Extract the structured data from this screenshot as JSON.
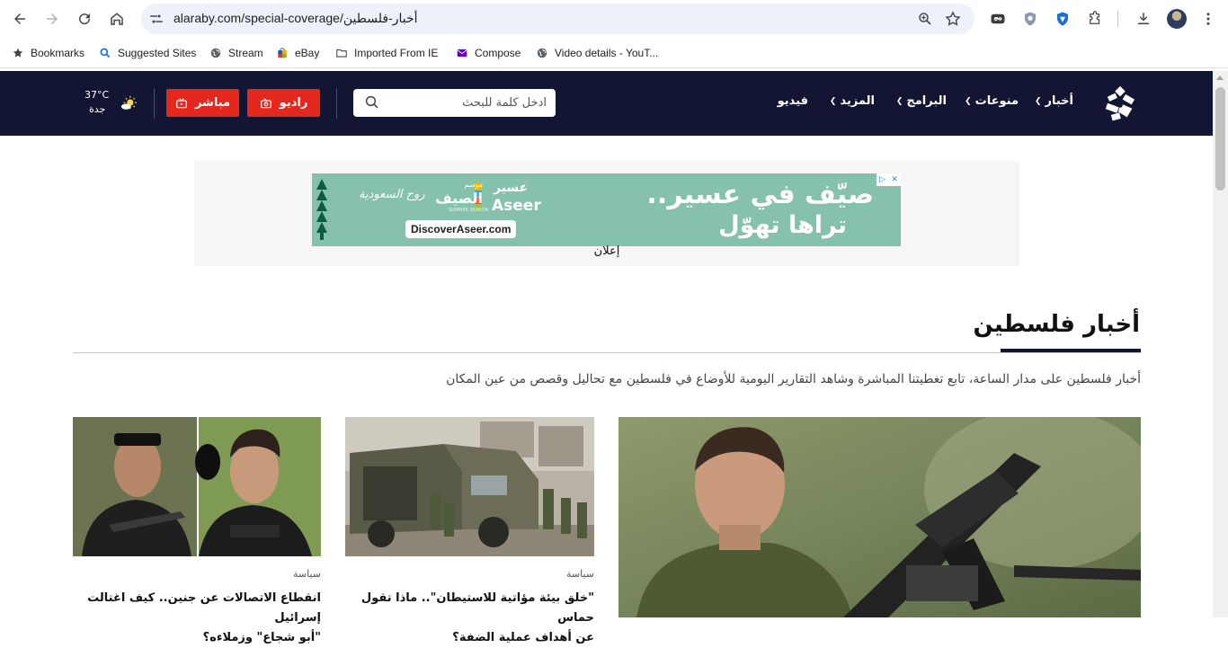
{
  "browser": {
    "url_host": "alaraby.com",
    "url_path": "/special-coverage/أخبار-فلسطين",
    "bookmarks": [
      {
        "label": "Bookmarks",
        "icon": "star-icon"
      },
      {
        "label": "Suggested Sites",
        "icon": "search-icon"
      },
      {
        "label": "Stream",
        "icon": "globe-icon"
      },
      {
        "label": "eBay",
        "icon": "shopping-bag-icon"
      },
      {
        "label": "Imported From IE",
        "icon": "folder-icon"
      },
      {
        "label": "Compose",
        "icon": "mail-icon"
      },
      {
        "label": "Video details - YouT...",
        "icon": "globe-icon"
      }
    ]
  },
  "header": {
    "nav": [
      {
        "label": "أخبار",
        "has_dropdown": true
      },
      {
        "label": "منوعات",
        "has_dropdown": true
      },
      {
        "label": "البرامج",
        "has_dropdown": true
      },
      {
        "label": "المزيد",
        "has_dropdown": true
      },
      {
        "label": "فيديو",
        "has_dropdown": false
      }
    ],
    "search_placeholder": "ادخل كلمة للبحث",
    "radio_label": "راديو",
    "live_label": "مباشر",
    "weather": {
      "temp": "37°C",
      "city": "جدة"
    },
    "colors": {
      "bar": "#121633",
      "accent": "#e4281e"
    }
  },
  "ad": {
    "headline_line1": "صيّف في عسير..",
    "headline_line2": "تراها تهوّل",
    "brand_ar": "عسير",
    "brand_en": "Aseer",
    "season_small": "موسم",
    "season_ar": "الصيف",
    "season_en": "SUMMER SEASON",
    "saudi": "روح السعودية",
    "domain": "DiscoverAseer.com",
    "label": "إعلان"
  },
  "section": {
    "title": "أخبار فلسطين",
    "description": "أخبار فلسطين على مدار الساعة، تابع تغطيتنا المباشرة وشاهد التقارير اليومية للأوضاع في فلسطين مع تحاليل وقصص من عين المكان"
  },
  "cards": [
    {
      "category": "",
      "title": ""
    },
    {
      "category": "سياسة",
      "title_line1": "\"خلق بيئة مؤاتية للاستيطان\".. ماذا تقول حماس",
      "title_line2": "عن أهداف عملية الضفة؟"
    },
    {
      "category": "سياسة",
      "title_line1": "انقطاع الاتصالات عن جنين.. كيف اغتالت إسرائيل",
      "title_line2": "\"أبو شجاع\" وزملاءه؟"
    }
  ]
}
